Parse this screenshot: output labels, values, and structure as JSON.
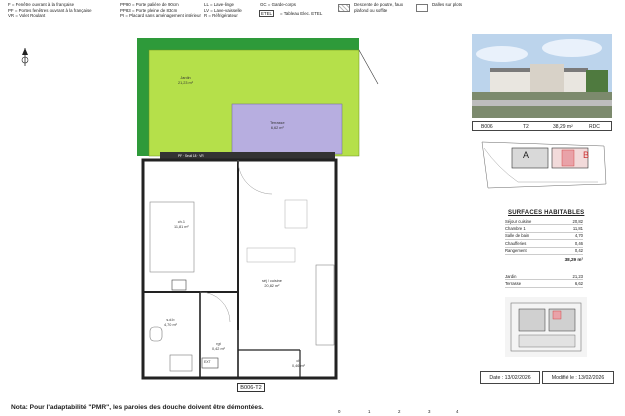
{
  "legend": {
    "col1": [
      "F = Fenêtre ouvrant à la française",
      "PF = Portes fenêtres ouvrant à la française",
      "VR = Volet Roulant"
    ],
    "col2": [
      "PP90 = Porte palière de 90cm",
      "PP83 = Porte pleine de 83cm",
      "PI = Placard sans aménagement intérieur"
    ],
    "col3": [
      "LL = Lave-linge",
      "LV = Lave-vaisselle",
      "R = Réfrigérateur"
    ],
    "col4": [
      "GC = Garde-corps",
      "ETEL",
      "= Tableau Elec. ETEL"
    ],
    "hatch_label": "Descente de poutre, faux plafond ou soffite",
    "plain_label": "Dalles sur plots"
  },
  "header_info": {
    "lot": "B006",
    "type": "T2",
    "area": "38,29 m²",
    "level": "RDC"
  },
  "site_labels": {
    "a": "A",
    "b": "B"
  },
  "surfaces": {
    "title": "SURFACES HABITABLES",
    "rows": [
      {
        "label": "Séjour cuisine",
        "value": "20,82"
      },
      {
        "label": "Chambre 1",
        "value": "11,81"
      },
      {
        "label": "Salle de bain",
        "value": "4,70"
      },
      {
        "label": "Chaufferies",
        "value": "0,46"
      },
      {
        "label": "Rangement",
        "value": "0,42"
      }
    ],
    "total": "38,29 m²",
    "extras": [
      {
        "label": "Jardin",
        "value": "21,23"
      },
      {
        "label": "Terrasse",
        "value": "6,62"
      }
    ]
  },
  "dates": {
    "created": "Date : 13/02/2026",
    "modified": "Modifié le : 13/02/2026"
  },
  "note": "Nota: Pour l'adaptabilité \"PMR\", les paroies des douche doivent être démontées.",
  "plan": {
    "title": "B006-T2",
    "jardin": [
      "Jardin",
      "21,23 m²"
    ],
    "terrasse": [
      "Terrasse",
      "6,62 m²"
    ],
    "chambre": [
      "ch.1",
      "11,81 m²"
    ],
    "sejour": [
      "séj / cuisine",
      "20,82 m²"
    ],
    "sdb": [
      "s.d.b",
      "4,70 m²"
    ],
    "rgt": [
      "rgt",
      "0,42 m²"
    ],
    "ch_small": [
      "ch",
      "0,46 m²"
    ],
    "ext": "EXT",
    "beam": "PF · Seuil 18 · VR"
  },
  "scale_labels": [
    "0",
    "1",
    "2",
    "3",
    "4"
  ],
  "colors": {
    "garden": "#b5e04a",
    "hedge": "#2e9a3a",
    "terrace": "#b7aee0",
    "site_red": "#e9a2a8"
  }
}
